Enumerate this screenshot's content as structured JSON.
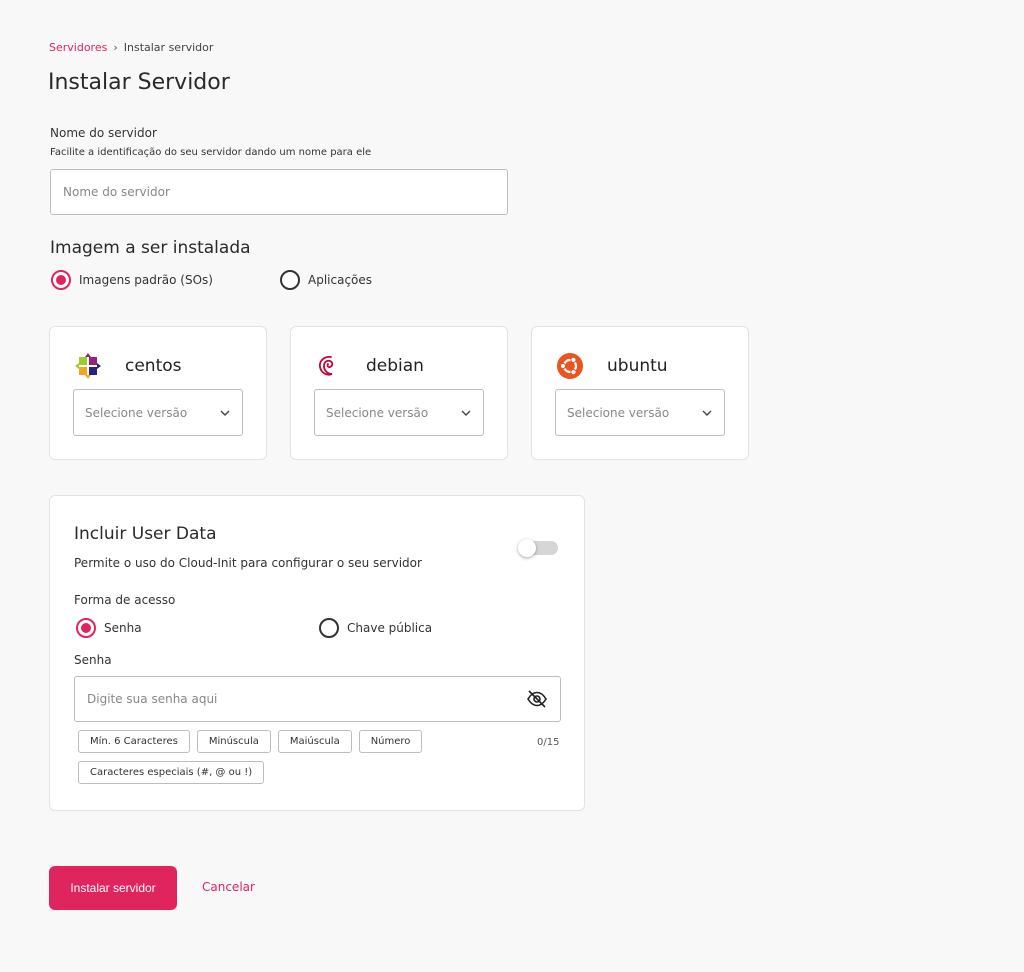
{
  "breadcrumb": {
    "parent": "Servidores",
    "separator": "›",
    "current": "Instalar servidor"
  },
  "page_title": "Instalar Servidor",
  "server_name": {
    "label": "Nome do servidor",
    "hint": "Facilite a identificação do seu servidor dando um nome para ele",
    "placeholder": "Nome do servidor",
    "value": ""
  },
  "image": {
    "title": "Imagem a ser instalada",
    "options": [
      {
        "label": "Imagens padrão (SOs)",
        "checked": true
      },
      {
        "label": "Aplicações",
        "checked": false
      }
    ],
    "os_cards": [
      {
        "name": "centos",
        "icon": "centos-logo-icon",
        "select_placeholder": "Selecione versão"
      },
      {
        "name": "debian",
        "icon": "debian-logo-icon",
        "select_placeholder": "Selecione versão"
      },
      {
        "name": "ubuntu",
        "icon": "ubuntu-logo-icon",
        "select_placeholder": "Selecione versão"
      }
    ]
  },
  "user_data": {
    "title": "Incluir User Data",
    "description": "Permite o uso do Cloud-Init para configurar o seu servidor",
    "toggle_on": false,
    "access_label": "Forma de acesso",
    "access_options": [
      {
        "label": "Senha",
        "checked": true
      },
      {
        "label": "Chave pública",
        "checked": false
      }
    ],
    "password_label": "Senha",
    "password_placeholder": "Digite sua senha aqui",
    "password_icon": "eye-off-icon",
    "counter": "0/15",
    "requirements": [
      "Mín. 6 Caracteres",
      "Minúscula",
      "Maiúscula",
      "Número",
      "Caracteres especiais (#, @ ou !)"
    ]
  },
  "actions": {
    "install": "Instalar servidor",
    "cancel": "Cancelar"
  },
  "colors": {
    "accent": "#e0245e",
    "background": "#f8f8f8"
  }
}
